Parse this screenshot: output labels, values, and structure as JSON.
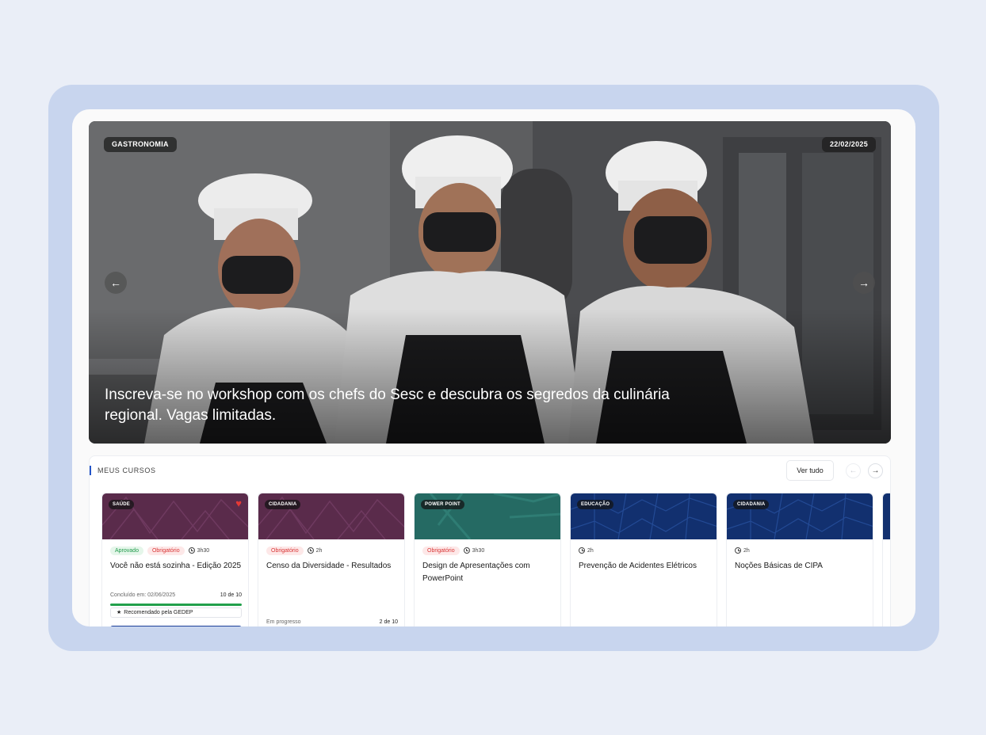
{
  "hero": {
    "category": "GASTRONOMIA",
    "date": "22/02/2025",
    "prev_icon": "arrow-left-icon",
    "next_icon": "arrow-right-icon",
    "caption": "Inscreva-se no workshop com os chefs do Sesc e descubra os segredos da culinária regional. Vagas limitadas."
  },
  "courses": {
    "title": "MEUS CURSOS",
    "see_all": "Ver tudo",
    "cards": [
      {
        "tag": "SAÚDE",
        "color": "#5a2b4b",
        "favorite": true,
        "badges": [
          "Aprovado",
          "Obrigatório"
        ],
        "duration": "3h30",
        "title": "Você não está sozinha - Edição 2025",
        "status": "Concluído em: 02/06/2025",
        "progress": "10 de 10",
        "progress_fraction": 1.0,
        "recommended": "Recomendado pela GEDEP"
      },
      {
        "tag": "CIDADANIA",
        "color": "#5a2b4b",
        "badges": [
          "Obrigatório"
        ],
        "duration": "2h",
        "title": "Censo da Diversidade - Resultados",
        "status": "Em progresso",
        "progress": "2 de 10",
        "progress_fraction": 0.2
      },
      {
        "tag": "POWER POINT",
        "color": "#256a63",
        "badges": [
          "Obrigatório"
        ],
        "duration": "3h30",
        "title": "Design de Apresentações com PowerPoint"
      },
      {
        "tag": "EDUCAÇÃO",
        "color": "#12306f",
        "badges": [],
        "duration": "2h",
        "title": "Prevenção de Acidentes Elétricos"
      },
      {
        "tag": "CIDADANIA",
        "color": "#12306f",
        "badges": [],
        "duration": "2h",
        "title": "Noções Básicas de CIPA"
      }
    ]
  }
}
